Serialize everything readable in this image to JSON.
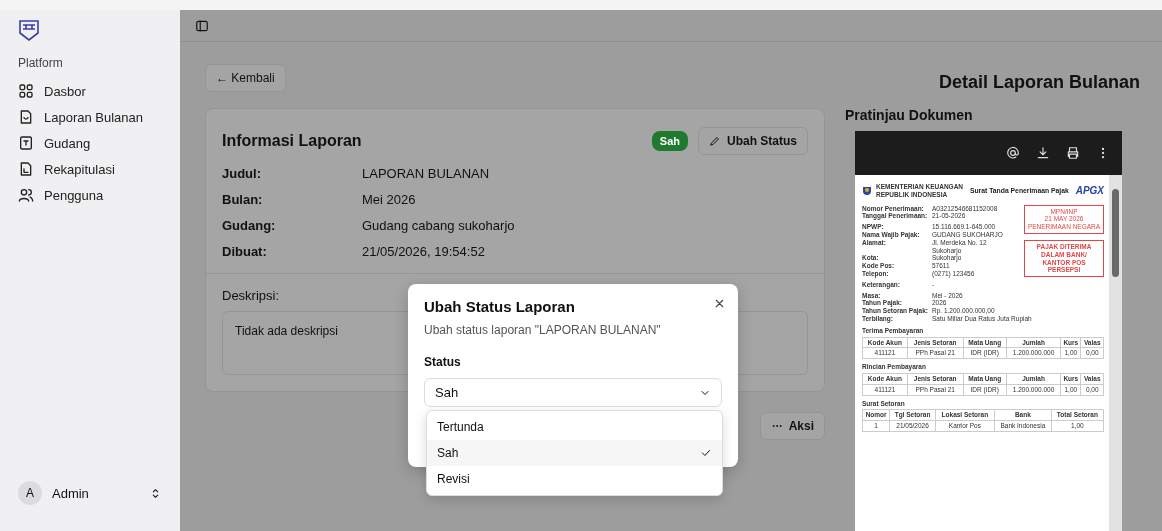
{
  "sidebar": {
    "section_label": "Platform",
    "items": [
      {
        "label": "Dasbor"
      },
      {
        "label": "Laporan Bulanan"
      },
      {
        "label": "Gudang"
      },
      {
        "label": "Rekapitulasi"
      },
      {
        "label": "Pengguna"
      }
    ],
    "user": {
      "initial": "A",
      "name": "Admin"
    }
  },
  "back_button": "← Kembali",
  "page_title": "Detail Laporan Bulanan",
  "report_card": {
    "title": "Informasi Laporan",
    "status_badge": "Sah",
    "edit_button": "Ubah Status",
    "fields": [
      {
        "label": "Judul:",
        "value": "LAPORAN BULANAN"
      },
      {
        "label": "Bulan:",
        "value": "Mei 2026"
      },
      {
        "label": "Gudang:",
        "value": "Gudang cabang sukoharjo"
      },
      {
        "label": "Dibuat:",
        "value": "21/05/2026, 19:54:52"
      }
    ],
    "description_label": "Deskripsi:",
    "description": "Tidak ada deskripsi"
  },
  "actions_button": "Aksi",
  "preview": {
    "title": "Pratinjau Dokumen",
    "document": {
      "issuer_lines": [
        "KEMENTERIAN KEUANGAN",
        "REPUBLIK INDONESIA"
      ],
      "title": "Surat Tanda Penerimaan Pajak",
      "brand": "APGX",
      "field_groups": [
        [
          {
            "label": "Nomor Penerimaan:",
            "lines": [
              "A03212546681152008"
            ]
          },
          {
            "label": "Tanggal Penerimaan:",
            "lines": [
              "21-05-2026"
            ]
          }
        ],
        [
          {
            "label": "NPWP:",
            "lines": [
              "15.116.669.1-645.000"
            ]
          },
          {
            "label": "Nama Wajib Pajak:",
            "lines": [
              "GUDANG SUKOHARJO"
            ]
          },
          {
            "label": "Alamat:",
            "lines": [
              "Jl. Merdeka No. 12",
              "Sukoharjo"
            ]
          },
          {
            "label": "Kota:",
            "lines": [
              "Sukoharjo"
            ]
          },
          {
            "label": "Kode Pos:",
            "lines": [
              "57611"
            ]
          },
          {
            "label": "Telepon:",
            "lines": [
              "(0271) 123456"
            ]
          }
        ],
        [
          {
            "label": "Keterangan:",
            "lines": [
              "-"
            ]
          }
        ],
        [
          {
            "label": "Masa:",
            "lines": [
              "Mei - 2026"
            ]
          },
          {
            "label": "Tahun Pajak:",
            "lines": [
              "2026"
            ]
          },
          {
            "label": "Tahun Setoran Pajak:",
            "lines": [
              "Rp. 1.200.000.000,00"
            ]
          },
          {
            "label": "Terbilang:",
            "lines": [
              "Satu Miliar Dua Ratus Juta Rupiah"
            ]
          }
        ]
      ],
      "stamps": [
        {
          "lines": [
            "MPN/INP",
            "21 MAY 2026",
            "PENERIMAAN NEGARA"
          ]
        },
        {
          "lines": [
            "PAJAK DITERIMA",
            "DALAM BANK/",
            "KANTOR POS",
            "PERSEPSI"
          ]
        }
      ],
      "tables": [
        {
          "title": "Terima Pembayaran",
          "columns": [
            "Kode Akun",
            "Jenis Setoran",
            "Mata Uang",
            "Jumlah",
            "Kurs",
            "Valas"
          ],
          "rows": [
            [
              "411121",
              "PPh Pasal 21",
              "IDR (IDR)",
              "1.200.000.000",
              "1,00",
              "0,00"
            ]
          ]
        },
        {
          "title": "Rincian Pembayaran",
          "columns": [
            "Kode Akun",
            "Jenis Setoran",
            "Mata Uang",
            "Jumlah",
            "Kurs",
            "Valas"
          ],
          "rows": [
            [
              "411121",
              "PPh Pasal 21",
              "IDR (IDR)",
              "1.200.000.000",
              "1,00",
              "0,00"
            ]
          ]
        },
        {
          "title": "Surat Setoran",
          "columns": [
            "Nomor",
            "Tgl Setoran",
            "Lokasi Setoran",
            "Bank",
            "Total Setoran"
          ],
          "rows": [
            [
              "1",
              "21/05/2026",
              "Kantor Pos",
              "Bank Indonesia",
              "1,00"
            ]
          ]
        }
      ]
    }
  },
  "dialog": {
    "title": "Ubah Status Laporan",
    "subtitle": "Ubah status laporan \"LAPORAN BULANAN\"",
    "field_label": "Status",
    "select_value": "Sah",
    "options": [
      {
        "label": "Tertunda",
        "selected": false
      },
      {
        "label": "Sah",
        "selected": true
      },
      {
        "label": "Revisi",
        "selected": false
      }
    ]
  }
}
